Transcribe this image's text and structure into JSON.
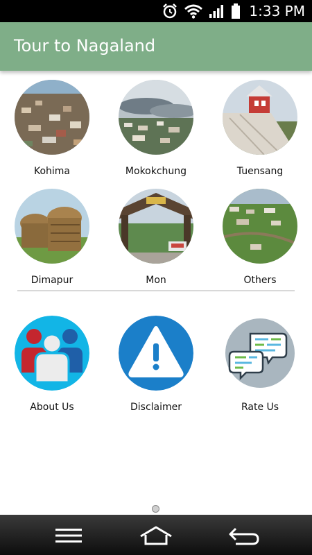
{
  "status_bar": {
    "time": "1:33 PM",
    "icons": [
      "alarm-icon",
      "wifi-icon",
      "signal-icon",
      "battery-icon"
    ]
  },
  "app": {
    "title": "Tour to Nagaland",
    "accent_color": "#7fae88"
  },
  "districts": [
    {
      "label": "Kohima",
      "image": "kohima-town-photo"
    },
    {
      "label": "Mokokchung",
      "image": "mokokchung-clouds-photo"
    },
    {
      "label": "Tuensang",
      "image": "tuensang-church-photo"
    },
    {
      "label": "Dimapur",
      "image": "dimapur-drums-photo"
    },
    {
      "label": "Mon",
      "image": "mon-gate-photo"
    },
    {
      "label": "Others",
      "image": "others-valley-photo"
    }
  ],
  "menu": [
    {
      "label": "About Us",
      "icon": "people-icon"
    },
    {
      "label": "Disclaimer",
      "icon": "warning-icon"
    },
    {
      "label": "Rate Us",
      "icon": "chat-bubbles-icon"
    }
  ],
  "nav_bar": {
    "icons": [
      "menu-icon",
      "home-icon",
      "back-icon"
    ]
  }
}
